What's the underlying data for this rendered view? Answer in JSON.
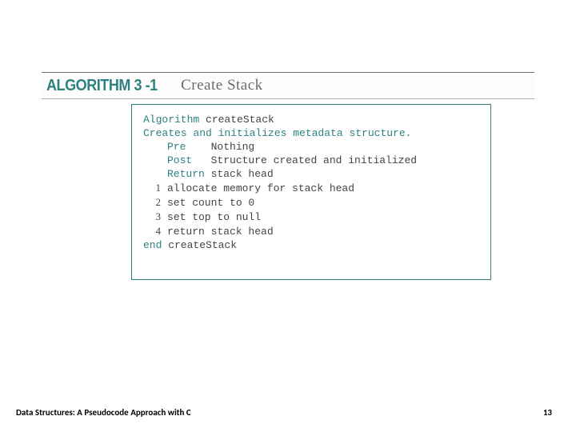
{
  "header": {
    "label": "ALGORITHM 3 -1",
    "title": "Create Stack"
  },
  "code": {
    "line1a": "Algorithm",
    "line1b": " createStack",
    "line2": "Creates and initializes metadata structure.",
    "pre_label": "Pre",
    "pre_text": "Nothing",
    "post_label": "Post",
    "post_text": "Structure created and initialized",
    "return_label": "Return",
    "return_text": " stack head",
    "steps": [
      "allocate memory for stack head",
      "set count to 0",
      "set top to null",
      "return stack head"
    ],
    "nums": [
      "1",
      "2",
      "3",
      "4"
    ],
    "end_a": "end",
    "end_b": " createStack"
  },
  "footer": {
    "left": "Data Structures: A Pseudocode Approach with C",
    "right": "13"
  }
}
